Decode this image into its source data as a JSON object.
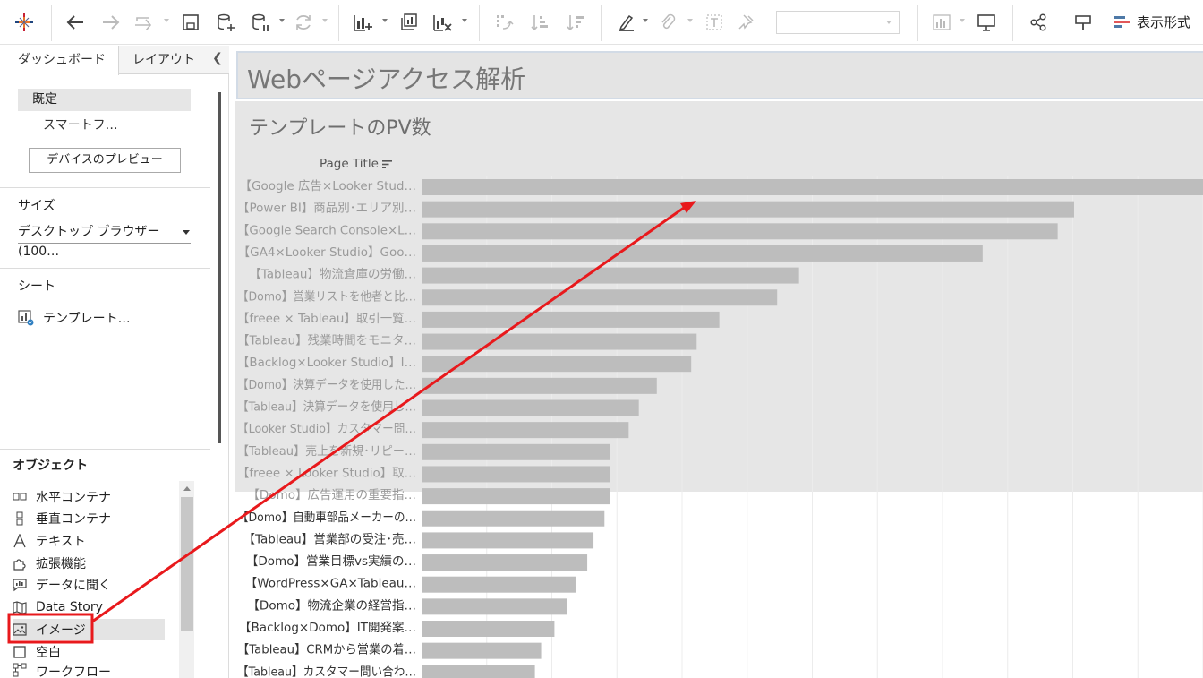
{
  "toolbar": {
    "show_label": "表示形式"
  },
  "left_panel": {
    "tabs": [
      "ダッシュボード",
      "レイアウト"
    ],
    "device_default": "既定",
    "device_phone": "スマートフ…",
    "device_preview_button": "デバイスのプレビュー",
    "size_title": "サイズ",
    "size_value": "デスクトップ ブラウザー (100…",
    "sheets_title": "シート",
    "sheet_item": "テンプレート…",
    "objects_title": "オブジェクト",
    "objects": [
      {
        "label": "水平コンテナ",
        "icon": "horizontal-container-icon"
      },
      {
        "label": "垂直コンテナ",
        "icon": "vertical-container-icon"
      },
      {
        "label": "テキスト",
        "icon": "text-icon"
      },
      {
        "label": "拡張機能",
        "icon": "extension-icon"
      },
      {
        "label": "データに聞く",
        "icon": "ask-data-icon"
      },
      {
        "label": "Data Story",
        "icon": "data-story-icon"
      },
      {
        "label": "イメージ",
        "icon": "image-icon",
        "selected": true
      },
      {
        "label": "空白",
        "icon": "blank-icon"
      },
      {
        "label": "ワークフロー",
        "icon": "workflow-icon"
      }
    ]
  },
  "dashboard": {
    "title": "Webページアクセス解析",
    "chart_title": "テンプレートのPV数",
    "column_header": "Page Title"
  },
  "chart_data": {
    "type": "bar",
    "orientation": "horizontal",
    "categories": [
      "【Google 広告×Looker Stud…",
      "【Power BI】商品別･エリア別…",
      "【Google Search Console×L…",
      "【GA4×Looker Studio】Goo…",
      "【Tableau】物流倉庫の労働…",
      "【Domo】営業リストを他者と比…",
      "【freee × Tableau】取引一覧…",
      "【Tableau】残業時間をモニタ…",
      "【Backlog×Looker Studio】I…",
      "【Domo】決算データを使用した…",
      "【Tableau】決算データを使用し…",
      "【Looker Studio】カスタマー問…",
      "【Tableau】売上を新規･リピー…",
      "【freee × Looker Studio】取…",
      "【Domo】広告運用の重要指…",
      "【Domo】自動車部品メーカーの…",
      "【Tableau】営業部の受注･売…",
      "【Domo】営業目標vs実績の…",
      "【WordPress×GA×Tableau…",
      "【Domo】物流企業の経営指…",
      "【Backlog×Domo】IT開発案…",
      "【Tableau】CRMから営業の着…",
      "【Tableau】カスタマー問い合わ…"
    ],
    "values": [
      100,
      83.5,
      81.4,
      71.8,
      48.3,
      45.5,
      38.1,
      35.2,
      34.5,
      30.1,
      27.8,
      26.5,
      24.1,
      24.1,
      24.1,
      23.4,
      22.0,
      21.2,
      19.7,
      18.6,
      17.0,
      15.3,
      14.5
    ],
    "bar_color": "#bdbdbd",
    "xlim": [
      0,
      100
    ],
    "grid": true,
    "highlight_rows": 15
  },
  "annotation": {
    "color": "#e8191c"
  }
}
